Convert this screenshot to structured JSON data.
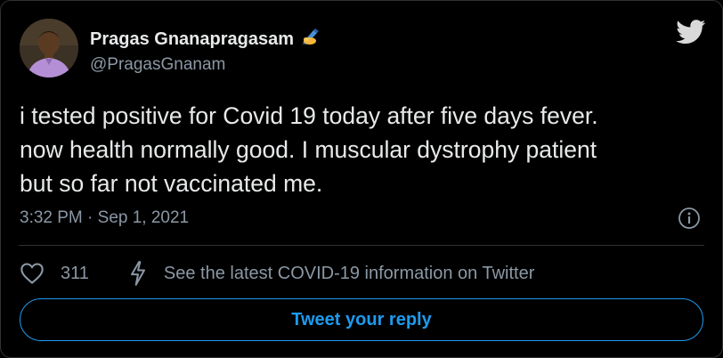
{
  "author": {
    "display_name": "Pragas Gnanapragasam",
    "handle": "@PragasGnanam",
    "avatar": "profile-photo",
    "name_emoji": "writing-hand-icon"
  },
  "brand_icon": "twitter-bird-icon",
  "tweet": {
    "lines": [
      "i tested positive for Covid 19 today after five days fever.",
      "now health normally good. I muscular dystrophy patient",
      "but so far not vaccinated me."
    ],
    "timestamp": "3:32 PM · Sep 1, 2021"
  },
  "actions": {
    "like_icon": "heart-icon",
    "like_count": "311",
    "covid_icon": "lightning-icon",
    "covid_link": "See the latest COVID-19 information on Twitter"
  },
  "reply_button": "Tweet your reply",
  "info_icon": "info-icon",
  "colors": {
    "background": "#000000",
    "text_primary": "#e7e9ea",
    "text_secondary": "#8b98a5",
    "accent": "#1d9bf0",
    "border": "#2f3336"
  }
}
